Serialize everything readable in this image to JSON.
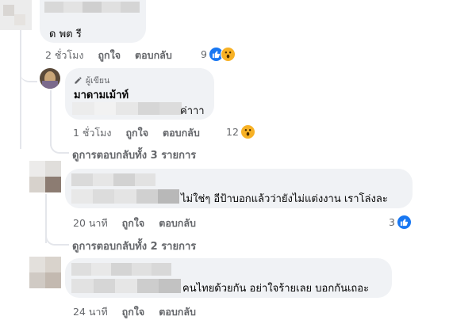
{
  "comments": [
    {
      "text": "ด พต รี",
      "time": "2 ชั่วโมง",
      "like_label": "ถูกใจ",
      "reply_label": "ตอบกลับ",
      "reaction_count": "9"
    },
    {
      "badge": "ผู้เขียน",
      "name": "มาดามเม้าท์",
      "text": "ค่าาา",
      "time": "1 ชั่วโมง",
      "like_label": "ถูกใจ",
      "reply_label": "ตอบกลับ",
      "reaction_count": "12"
    },
    {
      "view_replies": "ดูการตอบกลับทั้ง 3 รายการ"
    },
    {
      "text": "ไม่ใช่ๆ อีป้าบอกแล้วว่ายังไม่แต่งงาน เราโล่งละ",
      "time": "20 นาที",
      "like_label": "ถูกใจ",
      "reply_label": "ตอบกลับ",
      "reaction_count": "3"
    },
    {
      "view_replies": "ดูการตอบกลับทั้ง 2 รายการ"
    },
    {
      "text": "คนไทยด้วยกัน อย่าใจร้ายเลย บอกกันเถอะ",
      "time": "24 นาที",
      "like_label": "ถูกใจ",
      "reply_label": "ตอบกลับ"
    }
  ],
  "colors": {
    "bubble": "#f0f2f5",
    "meta_text": "#65676b",
    "like_blue": "#1877f2",
    "wow_yellow": "#f7b125"
  },
  "icons": [
    "pencil-icon",
    "like-reaction-icon",
    "wow-reaction-icon"
  ]
}
